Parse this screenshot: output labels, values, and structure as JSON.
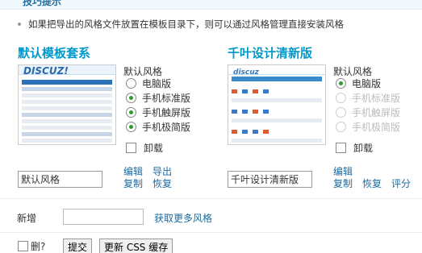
{
  "header": {
    "title": "技巧提示"
  },
  "tip": "如果把导出的风格文件放置在模板目录下，则可以通过风格管理直接安装风格",
  "styles": [
    {
      "name": "默认模板套系",
      "mode_label": "默认风格",
      "options": [
        {
          "label": "电脑版",
          "state": "unchecked"
        },
        {
          "label": "手机标准版",
          "state": "checked"
        },
        {
          "label": "手机触屏版",
          "state": "checked"
        },
        {
          "label": "手机极简版",
          "state": "checked"
        }
      ],
      "uninstall_label": "卸载",
      "input_value": "默认风格",
      "actions": {
        "edit": "编辑",
        "export": "导出",
        "copy": "复制",
        "restore": "恢复"
      }
    },
    {
      "name": "千叶设计清新版",
      "mode_label": "默认风格",
      "options": [
        {
          "label": "电脑版",
          "state": "checked"
        },
        {
          "label": "手机标准版",
          "state": "disabled"
        },
        {
          "label": "手机触屏版",
          "state": "disabled"
        },
        {
          "label": "手机极简版",
          "state": "disabled"
        }
      ],
      "uninstall_label": "卸载",
      "input_value": "千叶设计清新版",
      "actions": {
        "edit": "编辑",
        "copy": "复制",
        "restore": "恢复",
        "rate": "评分"
      }
    }
  ],
  "add": {
    "label": "新增",
    "value": "",
    "more_link": "获取更多风格"
  },
  "footer": {
    "delete_label": "删?",
    "submit_label": "提交",
    "update_css_label": "更新 CSS 缓存"
  },
  "thumb1": {
    "logo": "DISCUZ!"
  },
  "thumb2": {
    "logo": "discuz"
  }
}
